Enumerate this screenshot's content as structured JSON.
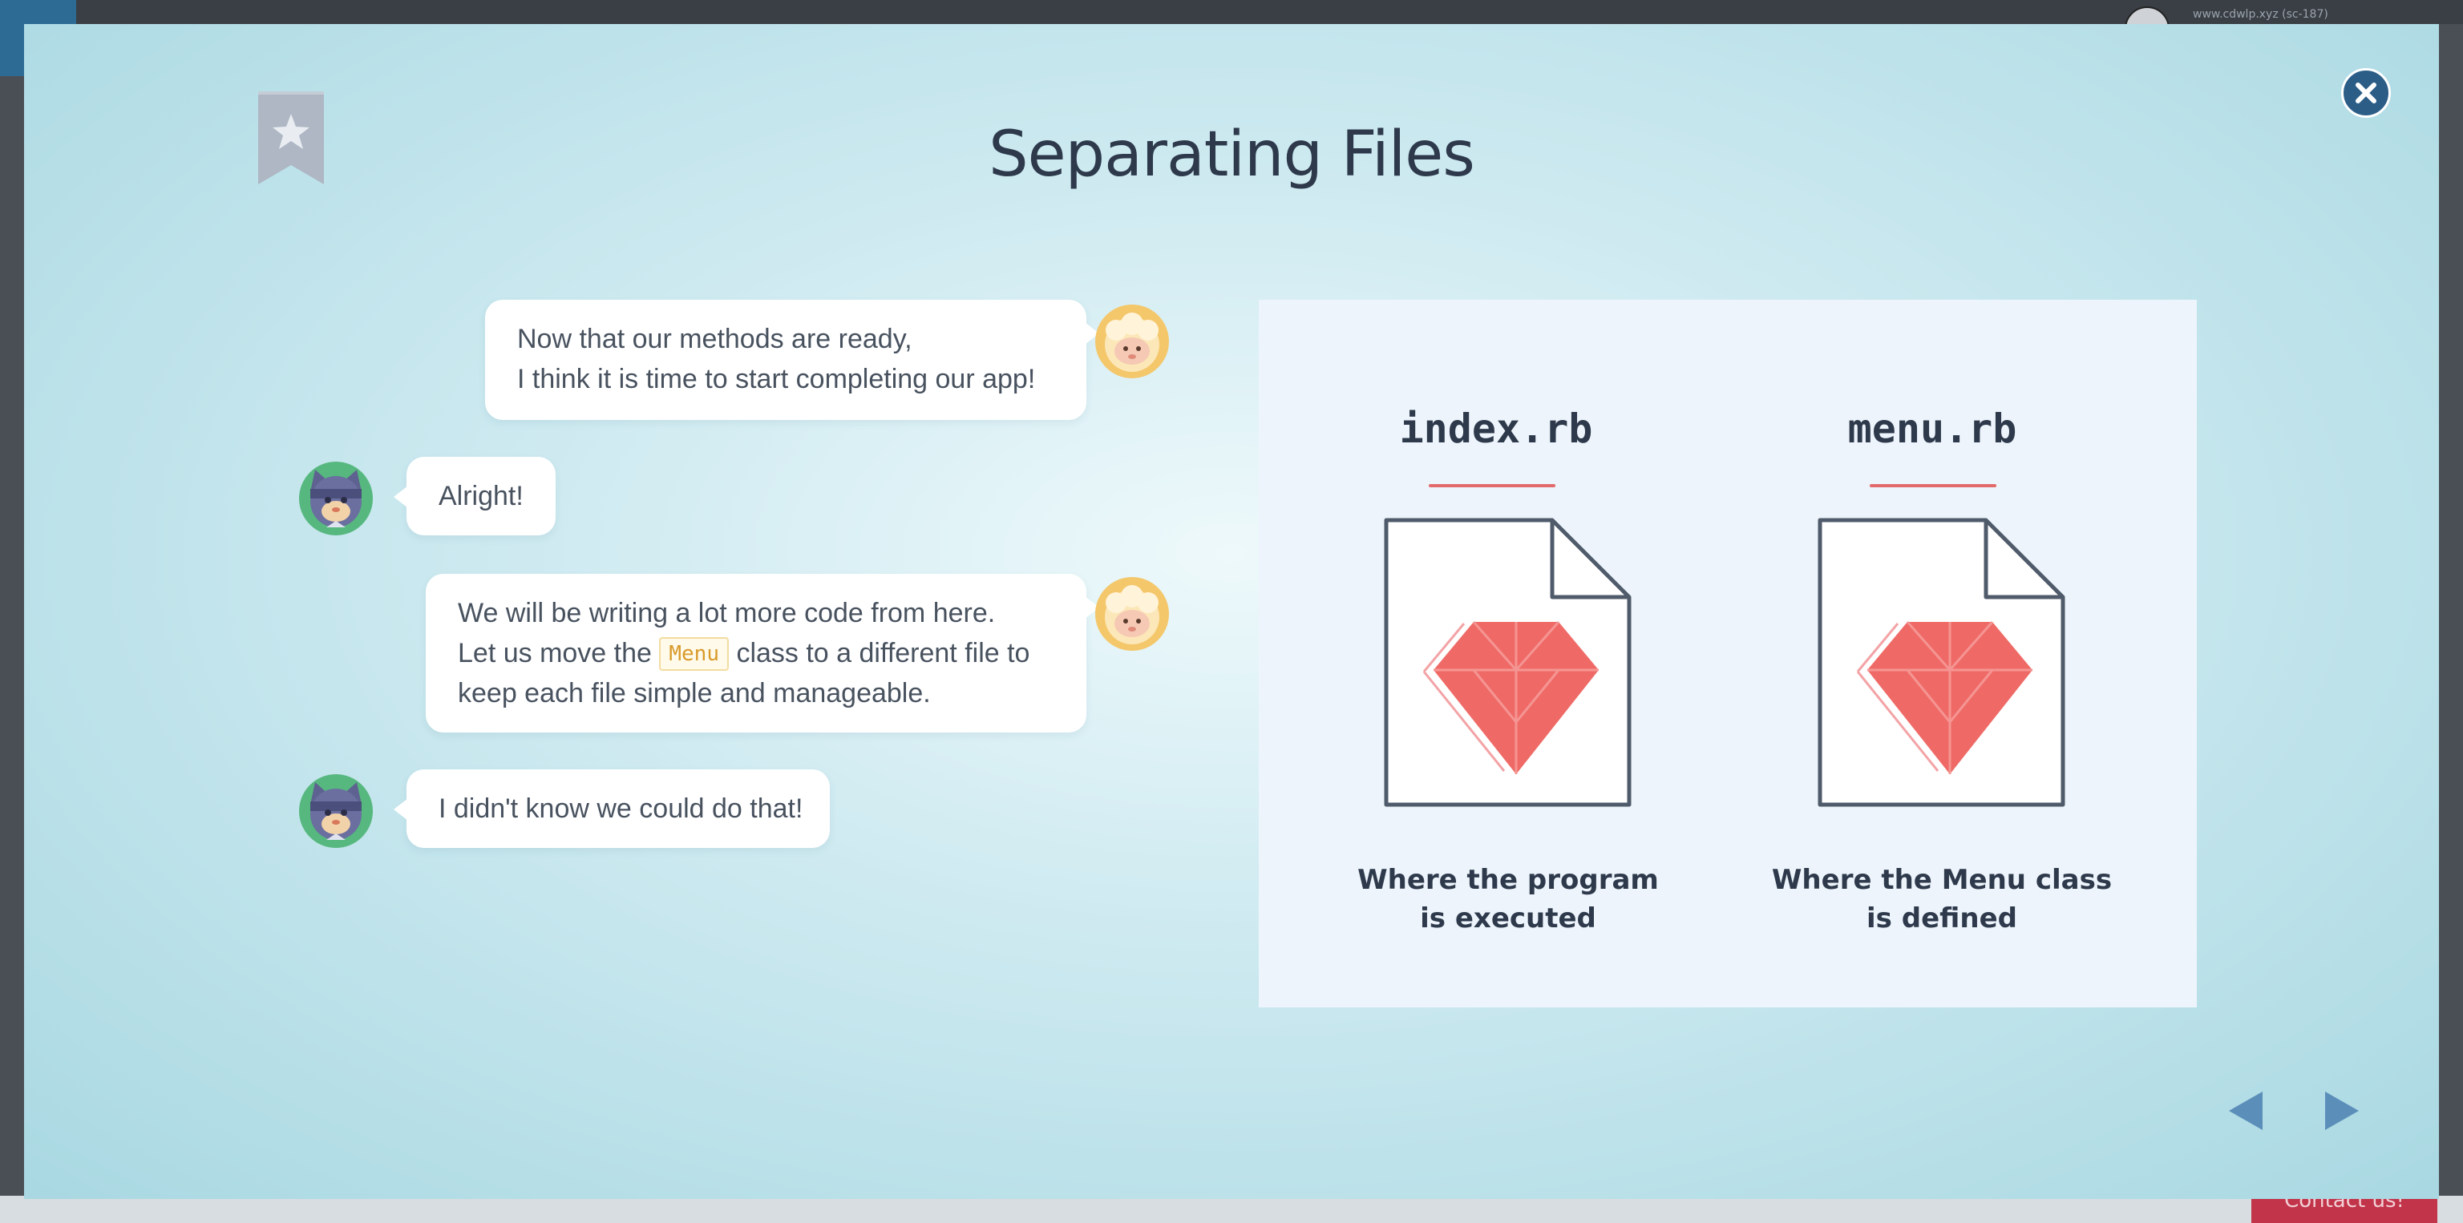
{
  "background": {
    "top_text": "www.cdwlp.xyz (sc-187)",
    "contact_label": "Contact us!"
  },
  "modal": {
    "title": "Separating Files",
    "chat": [
      {
        "speaker": "sheep",
        "side": "right",
        "lines": [
          "Now that our methods are ready,",
          "I think it is time to start completing our app!"
        ]
      },
      {
        "speaker": "ninja-cat",
        "side": "left",
        "lines": [
          "Alright!"
        ]
      },
      {
        "speaker": "sheep",
        "side": "right",
        "line1": "We will be writing a lot more code from here.",
        "line2_before": "Let us move the",
        "code": "Menu",
        "line2_after": "class to a different file to",
        "line3": "keep each file simple and manageable."
      },
      {
        "speaker": "ninja-cat",
        "side": "left",
        "lines": [
          "I didn't know we could do that!"
        ]
      }
    ],
    "illustration": {
      "files": [
        {
          "name": "index.rb",
          "caption_line1": "Where the program",
          "caption_line2": "is executed"
        },
        {
          "name": "menu.rb",
          "caption_line1": "Where the Menu class",
          "caption_line2": "is defined"
        }
      ]
    }
  },
  "icons": {
    "bookmark": "star-bookmark-icon",
    "close": "close-icon",
    "prev": "triangle-left-icon",
    "next": "triangle-right-icon",
    "file": "document-icon",
    "ruby": "ruby-gem-icon"
  },
  "colors": {
    "title": "#2e3a4c",
    "ruby": "#ef6a66",
    "close_button": "#2b5d87",
    "nav_arrow": "#5b8fba"
  }
}
